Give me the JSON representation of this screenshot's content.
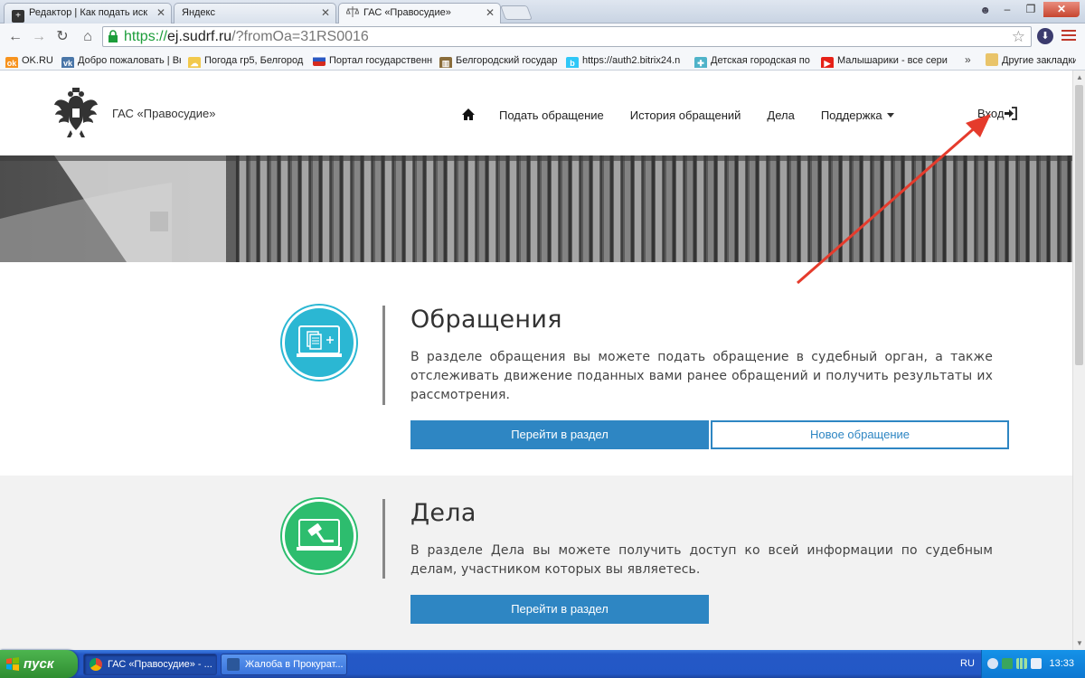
{
  "browser": {
    "tabs": [
      {
        "title": "Редактор | Как подать иск",
        "icon": "plus-icon"
      },
      {
        "title": "Яндекс",
        "icon": ""
      },
      {
        "title": "ГАС «Правосудие»",
        "icon": "scales-icon",
        "active": true
      }
    ],
    "omnibox": {
      "scheme": "https://",
      "host": "ej.sudrf.ru",
      "path": "/?fromOa=31RS0016"
    },
    "bookmarks": [
      {
        "label": "OK.RU",
        "icon": "ok-icon",
        "color": "#f7931e"
      },
      {
        "label": "Добро пожаловать | Вк",
        "icon": "vk-icon",
        "color": "#4a76a8"
      },
      {
        "label": "Погода  гр5, Белгород",
        "icon": "weather-icon",
        "color": "#f2c94c"
      },
      {
        "label": "Портал государственн",
        "icon": "russia-flag-icon",
        "color": "#d52b1e"
      },
      {
        "label": "Белгородский государ",
        "icon": "building-icon",
        "color": "#8a6d3b"
      },
      {
        "label": "https://auth2.bitrix24.n",
        "icon": "bitrix-icon",
        "color": "#2fc7f7"
      },
      {
        "label": "Детская городская по",
        "icon": "cross-icon",
        "color": "#4fb3c9"
      },
      {
        "label": "Малышарики - все сери",
        "icon": "youtube-icon",
        "color": "#e62117"
      }
    ],
    "bookmarks_more": "»",
    "other_bookmarks": "Другие закладки"
  },
  "site": {
    "name": "ГАС «Правосудие»",
    "nav": [
      {
        "label": "Подать обращение"
      },
      {
        "label": "История обращений"
      },
      {
        "label": "Дела"
      },
      {
        "label": "Поддержка",
        "dropdown": true
      }
    ],
    "login": "Вход"
  },
  "sections": {
    "appeals": {
      "title": "Обращения",
      "text": "В разделе обращения вы можете подать обращение в судебный орган, а также отслеживать движение поданных вами ранее обращений и получить результаты их рассмотрения.",
      "primary_button": "Перейти в раздел",
      "secondary_button": "Новое обращение",
      "accent": "#2bb7d3"
    },
    "cases": {
      "title": "Дела",
      "text": "В разделе Дела вы можете получить доступ ко всей информации по судебным делам, участником которых вы являетесь.",
      "primary_button": "Перейти в раздел",
      "accent": "#2dbd6e"
    }
  },
  "colors": {
    "button_primary": "#2e86c3",
    "annotation_arrow": "#e53b2c"
  },
  "taskbar": {
    "start": "пуск",
    "tasks": [
      {
        "label": "ГАС «Правосудие» - ...",
        "icon": "chrome-icon",
        "active": true
      },
      {
        "label": "Жалоба в Прокурат...",
        "icon": "word-icon"
      }
    ],
    "language": "RU",
    "clock": "13:33"
  }
}
